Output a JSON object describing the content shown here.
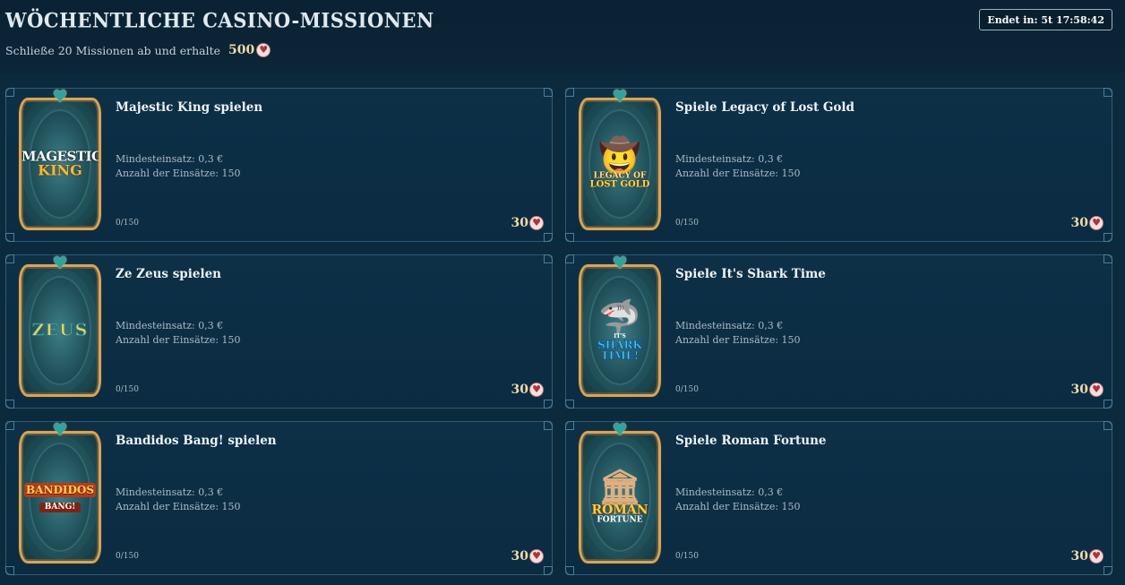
{
  "header": {
    "title": "Wöchentliche Casino-Missionen",
    "subtitle": "Schließe 20 Missionen ab und erhalte",
    "total_reward": "500",
    "timer_label": "Endet in: 5t 17:58:42"
  },
  "missions": [
    {
      "title": "Majestic King spielen",
      "min_bet": "Mindesteinsatz: 0,3 €",
      "bet_count": "Anzahl der Einsätze: 150",
      "progress": "0/150",
      "reward": "30",
      "logo_line1": "MAGESTIC",
      "logo_line2": "KING",
      "icon": "majestic-king-logo"
    },
    {
      "title": "Spiele Legacy of Lost Gold",
      "min_bet": "Mindesteinsatz: 0,3 €",
      "bet_count": "Anzahl der Einsätze: 150",
      "progress": "0/150",
      "reward": "30",
      "logo_line1": "LEGACY OF",
      "logo_line2": "LOST GOLD",
      "icon": "legacy-of-lost-gold-logo"
    },
    {
      "title": "Ze Zeus spielen",
      "min_bet": "Mindesteinsatz: 0,3 €",
      "bet_count": "Anzahl der Einsätze: 150",
      "progress": "0/150",
      "reward": "30",
      "logo_line1": "ZEUS",
      "logo_line2": "",
      "icon": "ze-zeus-logo"
    },
    {
      "title": "Spiele It's Shark Time",
      "min_bet": "Mindesteinsatz: 0,3 €",
      "bet_count": "Anzahl der Einsätze: 150",
      "progress": "0/150",
      "reward": "30",
      "logo_line1": "IT'S",
      "logo_line2": "SHARK TIME!",
      "icon": "shark-time-logo"
    },
    {
      "title": "Bandidos Bang! spielen",
      "min_bet": "Mindesteinsatz: 0,3 €",
      "bet_count": "Anzahl der Einsätze: 150",
      "progress": "0/150",
      "reward": "30",
      "logo_line1": "BANDIDOS",
      "logo_line2": "BANG!",
      "icon": "bandidos-bang-logo"
    },
    {
      "title": "Spiele Roman Fortune",
      "min_bet": "Mindesteinsatz: 0,3 €",
      "bet_count": "Anzahl der Einsätze: 150",
      "progress": "0/150",
      "reward": "30",
      "logo_line1": "ROMAN",
      "logo_line2": "FORTUNE",
      "icon": "roman-fortune-logo"
    }
  ],
  "colors": {
    "background": "#0c2a3e",
    "card_border": "#2e5a72",
    "frame_gold": "#c9a86a",
    "reward_text": "#f0d9a8",
    "heart": "#b0323a"
  }
}
